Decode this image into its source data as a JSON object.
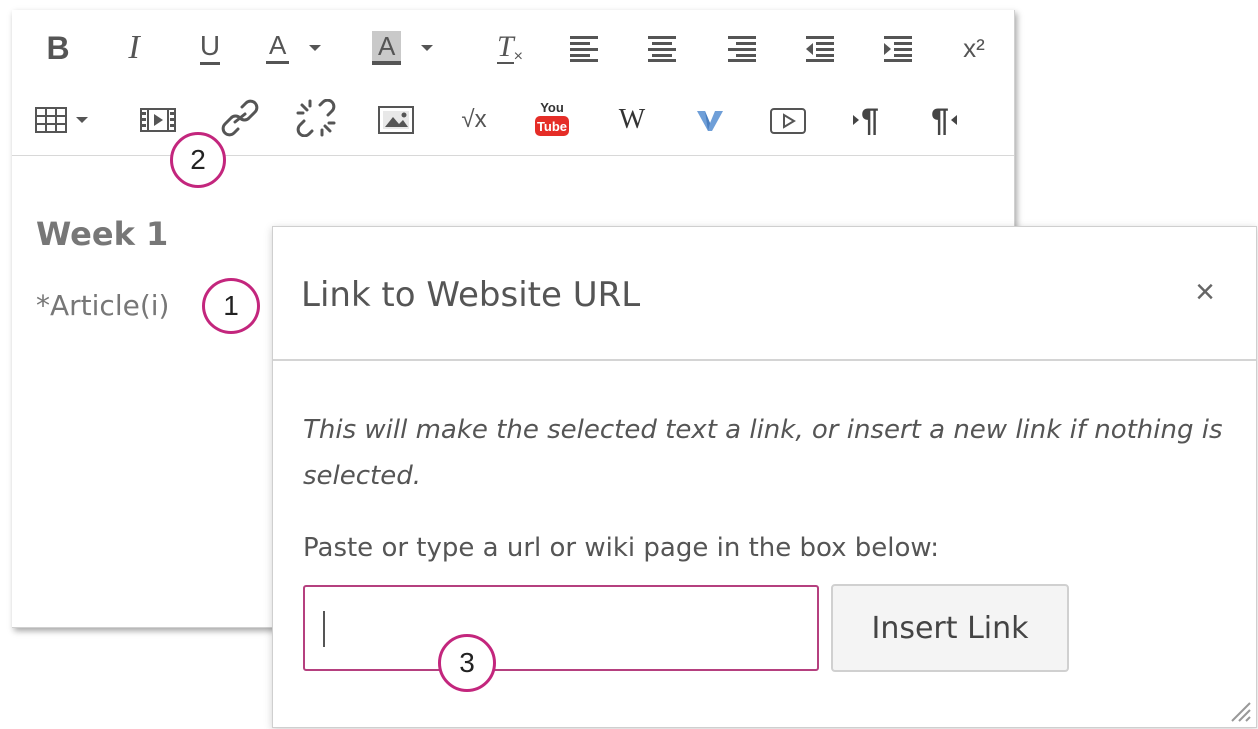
{
  "toolbar": {
    "row1": [
      {
        "name": "bold-button",
        "glyph": "B"
      },
      {
        "name": "italic-button",
        "glyph": "I"
      },
      {
        "name": "underline-button",
        "glyph": "U"
      },
      {
        "name": "text-color-button",
        "glyph": "A"
      },
      {
        "name": "background-color-button",
        "glyph": "A"
      },
      {
        "name": "clear-formatting-button",
        "glyph": "T"
      },
      {
        "name": "align-left-button",
        "glyph": "align-left-icon"
      },
      {
        "name": "align-center-button",
        "glyph": "align-center-icon"
      },
      {
        "name": "align-right-button",
        "glyph": "align-right-icon"
      },
      {
        "name": "outdent-button",
        "glyph": "outdent-icon"
      },
      {
        "name": "indent-button",
        "glyph": "indent-icon"
      },
      {
        "name": "superscript-button",
        "glyph": "x²"
      }
    ],
    "row2": [
      {
        "name": "table-button",
        "glyph": "table-icon"
      },
      {
        "name": "media-button",
        "glyph": "film-icon"
      },
      {
        "name": "link-button",
        "glyph": "link-icon"
      },
      {
        "name": "unlink-button",
        "glyph": "unlink-icon"
      },
      {
        "name": "image-button",
        "glyph": "image-icon"
      },
      {
        "name": "equation-button",
        "glyph": "√x"
      },
      {
        "name": "youtube-button",
        "glyph": "You Tube"
      },
      {
        "name": "wikipedia-button",
        "glyph": "W"
      },
      {
        "name": "vimeo-button",
        "glyph": "V"
      },
      {
        "name": "video-button",
        "glyph": "play-icon"
      },
      {
        "name": "ltr-paragraph-button",
        "glyph": "¶"
      },
      {
        "name": "rtl-paragraph-button",
        "glyph": "¶"
      }
    ]
  },
  "editor": {
    "heading": "Week 1",
    "paragraph": "*Article(i)"
  },
  "callouts": {
    "one": "1",
    "two": "2",
    "three": "3"
  },
  "dialog": {
    "title": "Link to Website URL",
    "close_label": "×",
    "description": "This will make the selected text a link, or insert a new link if nothing is selected.",
    "input_label": "Paste or type a url or wiki page in the box below:",
    "url_value": "",
    "insert_button_label": "Insert Link"
  },
  "colors": {
    "callout_border": "#c3267d",
    "input_border": "#b5407f",
    "vimeo_blue": "#6f9fd8",
    "youtube_red": "#e52d27"
  }
}
